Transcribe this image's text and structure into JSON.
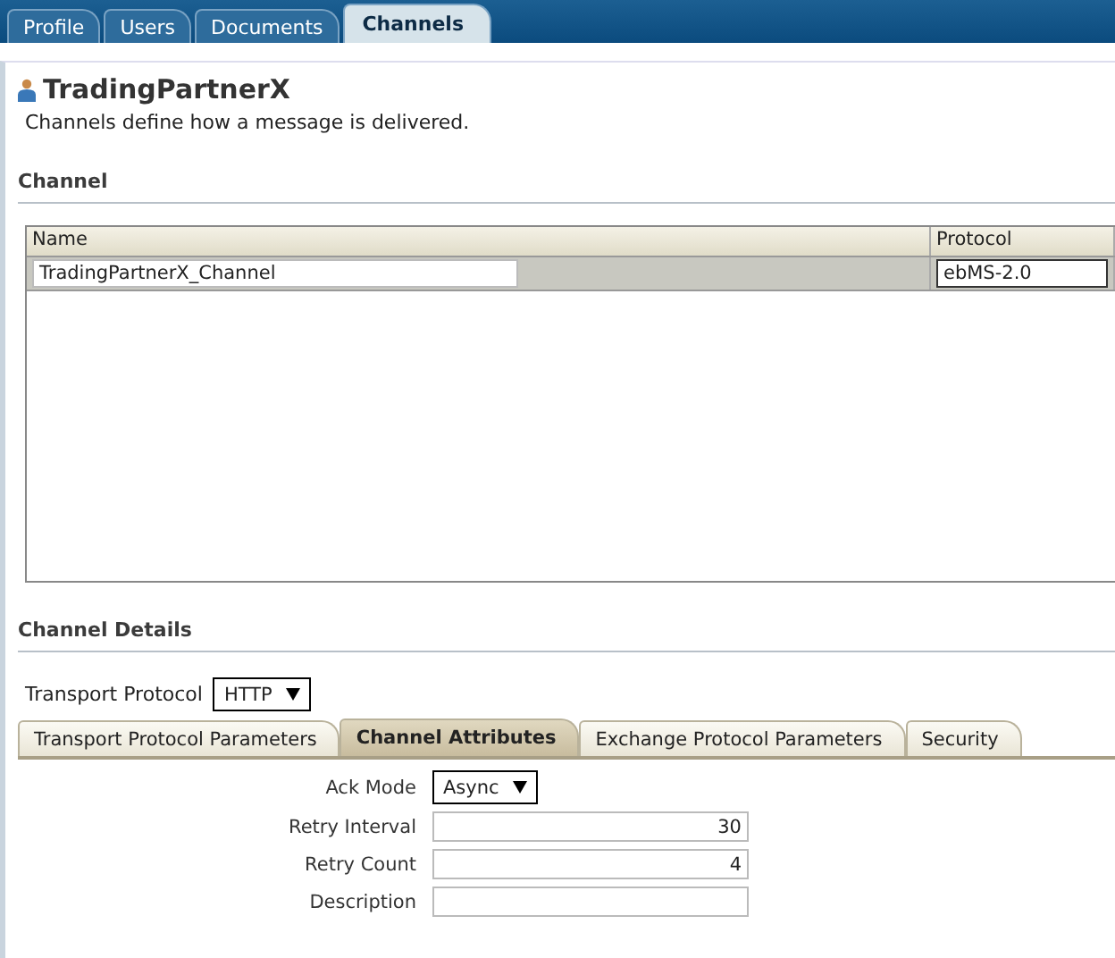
{
  "top_tabs": [
    {
      "label": "Profile",
      "selected": false
    },
    {
      "label": "Users",
      "selected": false
    },
    {
      "label": "Documents",
      "selected": false
    },
    {
      "label": "Channels",
      "selected": true
    }
  ],
  "header": {
    "title": "TradingPartnerX",
    "subtitle": "Channels define how a message is delivered."
  },
  "channel_section": {
    "title": "Channel",
    "table": {
      "columns": [
        "Name",
        "Protocol"
      ],
      "rows": [
        {
          "name": "TradingPartnerX_Channel",
          "protocol": "ebMS-2.0"
        }
      ]
    }
  },
  "details_section": {
    "title": "Channel Details",
    "transport_protocol": {
      "label": "Transport Protocol",
      "value": "HTTP"
    },
    "tabs": [
      {
        "label": "Transport Protocol Parameters",
        "selected": false
      },
      {
        "label": "Channel Attributes",
        "selected": true
      },
      {
        "label": "Exchange Protocol Parameters",
        "selected": false
      },
      {
        "label": "Security",
        "selected": false
      }
    ],
    "fields": [
      {
        "kind": "select",
        "label": "Ack Mode",
        "value": "Async"
      },
      {
        "kind": "number",
        "label": "Retry Interval",
        "value": "30"
      },
      {
        "kind": "number",
        "label": "Retry Count",
        "value": "4"
      },
      {
        "kind": "text",
        "label": "Description"
      }
    ]
  }
}
